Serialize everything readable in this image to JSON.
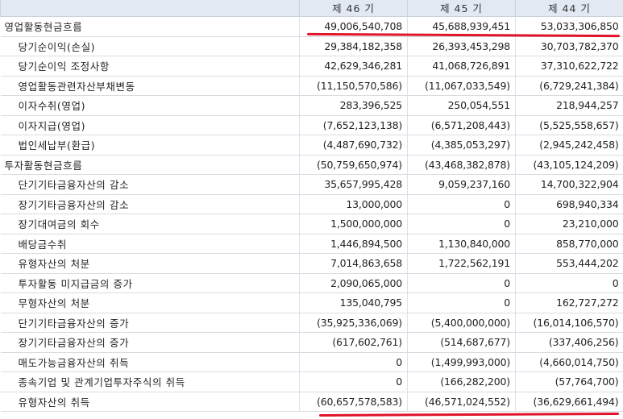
{
  "header": {
    "corner": "",
    "periods": [
      "제 46 기",
      "제 45 기",
      "제 44 기"
    ]
  },
  "rows": [
    {
      "label": "영업활동현금흐름",
      "level": 0,
      "values": [
        "49,006,540,708",
        "45,688,939,451",
        "53,033,306,850"
      ]
    },
    {
      "label": "당기순이익(손실)",
      "level": 1,
      "values": [
        "29,384,182,358",
        "26,393,453,298",
        "30,703,782,370"
      ]
    },
    {
      "label": "당기순이익 조정사항",
      "level": 1,
      "values": [
        "42,629,346,281",
        "41,068,726,891",
        "37,310,622,722"
      ]
    },
    {
      "label": "영업활동관련자산부채변동",
      "level": 1,
      "values": [
        "(11,150,570,586)",
        "(11,067,033,549)",
        "(6,729,241,384)"
      ]
    },
    {
      "label": "이자수취(영업)",
      "level": 1,
      "values": [
        "283,396,525",
        "250,054,551",
        "218,944,257"
      ]
    },
    {
      "label": "이자지급(영업)",
      "level": 1,
      "values": [
        "(7,652,123,138)",
        "(6,571,208,443)",
        "(5,525,558,657)"
      ]
    },
    {
      "label": "법인세납부(환급)",
      "level": 1,
      "values": [
        "(4,487,690,732)",
        "(4,385,053,297)",
        "(2,945,242,458)"
      ]
    },
    {
      "label": "투자활동현금흐름",
      "level": 0,
      "values": [
        "(50,759,650,974)",
        "(43,468,382,878)",
        "(43,105,124,209)"
      ]
    },
    {
      "label": "단기기타금융자산의 감소",
      "level": 1,
      "values": [
        "35,657,995,428",
        "9,059,237,160",
        "14,700,322,904"
      ]
    },
    {
      "label": "장기기타금융자산의 감소",
      "level": 1,
      "values": [
        "13,000,000",
        "0",
        "698,940,334"
      ]
    },
    {
      "label": "장기대여금의 회수",
      "level": 1,
      "values": [
        "1,500,000,000",
        "0",
        "23,210,000"
      ]
    },
    {
      "label": "배당금수취",
      "level": 1,
      "values": [
        "1,446,894,500",
        "1,130,840,000",
        "858,770,000"
      ]
    },
    {
      "label": "유형자산의 처분",
      "level": 1,
      "values": [
        "7,014,863,658",
        "1,722,562,191",
        "553,444,202"
      ]
    },
    {
      "label": "투자활동 미지급금의 증가",
      "level": 1,
      "values": [
        "2,090,065,000",
        "0",
        "0"
      ]
    },
    {
      "label": "무형자산의 처분",
      "level": 1,
      "values": [
        "135,040,795",
        "0",
        "162,727,272"
      ]
    },
    {
      "label": "단기기타금융자산의 증가",
      "level": 1,
      "values": [
        "(35,925,336,069)",
        "(5,400,000,000)",
        "(16,014,106,570)"
      ]
    },
    {
      "label": "장기기타금융자산의 증가",
      "level": 1,
      "values": [
        "(617,602,761)",
        "(514,687,677)",
        "(337,406,256)"
      ]
    },
    {
      "label": "매도가능금융자산의 취득",
      "level": 1,
      "values": [
        "0",
        "(1,499,993,000)",
        "(4,660,014,750)"
      ]
    },
    {
      "label": "종속기업 및 관계기업투자주식의 취득",
      "level": 1,
      "values": [
        "0",
        "(166,282,200)",
        "(57,764,700)"
      ]
    },
    {
      "label": "유형자산의 취득",
      "level": 1,
      "values": [
        "(60,657,578,583)",
        "(46,571,024,552)",
        "(36,629,661,494)"
      ]
    }
  ],
  "highlight_color": "#e0142a"
}
